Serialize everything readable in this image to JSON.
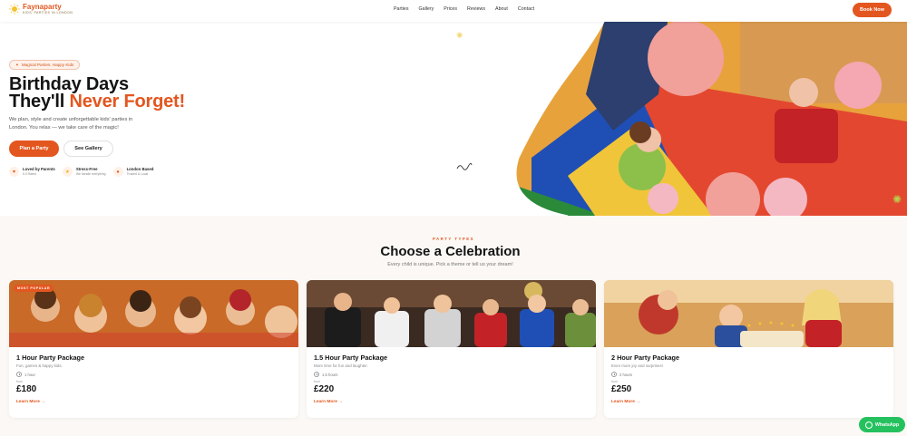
{
  "brand": {
    "name": "Faynaparty",
    "tagline": "Kids' Parties in London"
  },
  "nav": {
    "items": [
      "Parties",
      "Gallery",
      "Prices",
      "Reviews",
      "About",
      "Contact"
    ],
    "cta": "Book Now"
  },
  "hero": {
    "badge": "Magical Parties. Happy Kids",
    "headline_line1": "Birthday Days",
    "headline_line2_plain": "They'll",
    "headline_line2_accent": "Never Forget!",
    "subtitle": "We plan, style and create unforgettable kids' parties in London. You relax — we take care of the magic!",
    "primary_button": "Plan a Party",
    "secondary_button": "See Gallery",
    "features": [
      {
        "title": "Loved by Parents",
        "sub": "5.0 Rated",
        "icon": "heart-icon"
      },
      {
        "title": "Stress-Free",
        "sub": "We handle everything",
        "icon": "star-icon"
      },
      {
        "title": "London Based",
        "sub": "Trusted & Local",
        "icon": "pin-icon"
      }
    ]
  },
  "party_types": {
    "eyebrow": "PARTY TYPES",
    "title": "Choose a Celebration",
    "subtitle": "Every child is unique. Pick a theme or tell us your dream!",
    "cards": [
      {
        "badge": "MOST POPULAR",
        "title": "1 Hour Party Package",
        "desc": "Fun, games & happy kids.",
        "duration": "1 hour",
        "from": "from",
        "price": "£180",
        "link": "Learn More →"
      },
      {
        "badge": "",
        "title": "1.5 Hour Party Package",
        "desc": "More time for fun and laughter.",
        "duration": "1.5 hours",
        "from": "from",
        "price": "£220",
        "link": "Learn More →"
      },
      {
        "badge": "",
        "title": "2 Hour Party Package",
        "desc": "Even more joy and surprises!",
        "duration": "2 hours",
        "from": "from",
        "price": "£250",
        "link": "Learn More →"
      }
    ]
  },
  "whatsapp": {
    "label": "WhatsApp"
  },
  "colors": {
    "accent": "#e3561f",
    "whatsapp": "#25c15e",
    "section_bg": "#fbf8f5"
  }
}
